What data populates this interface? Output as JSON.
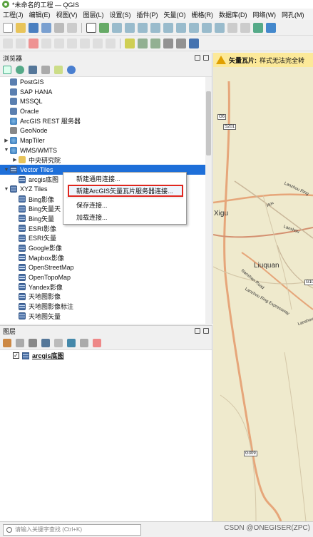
{
  "window": {
    "title": "*未命名的工程 — QGIS"
  },
  "menubar": [
    "工程(J)",
    "编辑(E)",
    "视图(V)",
    "图层(L)",
    "设置(S)",
    "插件(P)",
    "矢量(O)",
    "栅格(R)",
    "数据库(D)",
    "网络(W)",
    "网孔(M)"
  ],
  "browser": {
    "title": "浏览器",
    "items": [
      {
        "label": "PostGIS",
        "icon": "postgis-icon",
        "indent": 0,
        "arrow": ""
      },
      {
        "label": "SAP HANA",
        "icon": "hana-icon",
        "indent": 0,
        "arrow": ""
      },
      {
        "label": "MSSQL",
        "icon": "mssql-icon",
        "indent": 0,
        "arrow": ""
      },
      {
        "label": "Oracle",
        "icon": "oracle-icon",
        "indent": 0,
        "arrow": ""
      },
      {
        "label": "ArcGIS REST 服务器",
        "icon": "arcgis-icon",
        "indent": 0,
        "arrow": ""
      },
      {
        "label": "GeoNode",
        "icon": "geonode-icon",
        "indent": 0,
        "arrow": ""
      },
      {
        "label": "MapTiler",
        "icon": "maptiler-icon",
        "indent": 0,
        "arrow": "▶"
      },
      {
        "label": "WMS/WMTS",
        "icon": "wms-icon",
        "indent": 0,
        "arrow": "▼"
      },
      {
        "label": "中央研究院",
        "icon": "wms-layer-icon",
        "indent": 1,
        "arrow": "▶"
      },
      {
        "label": "Vector Tiles",
        "icon": "vector-tiles-icon",
        "indent": 0,
        "arrow": "▼",
        "selected": true
      },
      {
        "label": "arcgis底图",
        "icon": "vector-tile-layer-icon",
        "indent": 1,
        "arrow": ""
      },
      {
        "label": "XYZ Tiles",
        "icon": "xyz-icon",
        "indent": 0,
        "arrow": "▼"
      },
      {
        "label": "Bing影像",
        "icon": "tile-icon",
        "indent": 1,
        "arrow": ""
      },
      {
        "label": "Bing矢量天",
        "icon": "tile-icon",
        "indent": 1,
        "arrow": ""
      },
      {
        "label": "Bing矢量",
        "icon": "tile-icon",
        "indent": 1,
        "arrow": ""
      },
      {
        "label": "ESRI影像",
        "icon": "tile-icon",
        "indent": 1,
        "arrow": ""
      },
      {
        "label": "ESRI矢量",
        "icon": "tile-icon",
        "indent": 1,
        "arrow": ""
      },
      {
        "label": "Google影像",
        "icon": "tile-icon",
        "indent": 1,
        "arrow": ""
      },
      {
        "label": "Mapbox影像",
        "icon": "tile-icon",
        "indent": 1,
        "arrow": ""
      },
      {
        "label": "OpenStreetMap",
        "icon": "tile-icon",
        "indent": 1,
        "arrow": ""
      },
      {
        "label": "OpenTopoMap",
        "icon": "tile-icon",
        "indent": 1,
        "arrow": ""
      },
      {
        "label": "Yandex影像",
        "icon": "tile-icon",
        "indent": 1,
        "arrow": ""
      },
      {
        "label": "天地图影像",
        "icon": "tile-icon",
        "indent": 1,
        "arrow": ""
      },
      {
        "label": "天地图影像标注",
        "icon": "tile-icon",
        "indent": 1,
        "arrow": ""
      },
      {
        "label": "天地图矢量",
        "icon": "tile-icon",
        "indent": 1,
        "arrow": ""
      }
    ]
  },
  "context_menu": {
    "items": [
      {
        "label": "新建通用连接...",
        "highlighted": false
      },
      {
        "label": "新建ArcGIS矢量瓦片服务器连接...",
        "highlighted": true
      },
      {
        "label": "保存连接...",
        "highlighted": false
      },
      {
        "label": "加载连接...",
        "highlighted": false
      }
    ]
  },
  "layers": {
    "title": "图层",
    "items": [
      {
        "label": "arcgis底图",
        "checked": true
      }
    ]
  },
  "map": {
    "banner_label": "矢量瓦片:",
    "banner_text": "样式无法完全转",
    "labels": [
      "Xigu",
      "Liuquan",
      "Lanzhou Ring",
      "Nanshan Road",
      "Lanzhou Ring Expressway",
      "Lanshou Ring",
      "Lanshou",
      "Hoc"
    ],
    "road_tags": [
      "G6",
      "S201",
      "G309",
      "G10"
    ]
  },
  "status": {
    "search_placeholder": "请输入关键字查找 (Ctrl+K)"
  },
  "watermark": "CSDN @ONEGISER(ZPC)"
}
